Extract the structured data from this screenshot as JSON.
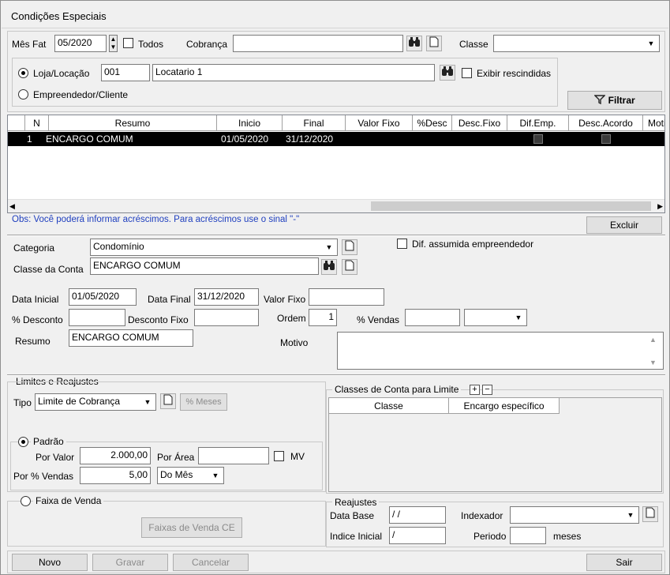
{
  "window": {
    "title": "Condições Especiais"
  },
  "filter": {
    "mes_fat_label": "Mês Fat",
    "mes_fat_value": "05/2020",
    "todos_label": "Todos",
    "cobranca_label": "Cobrança",
    "cobranca_value": "",
    "classe_label": "Classe",
    "classe_value": "",
    "loja_label": "Loja/Locação",
    "loja_code": "001",
    "loja_name": "Locatario 1",
    "exibir_rescindidas_label": "Exibir rescindidas",
    "empreendedor_label": "Empreendedor/Cliente",
    "filtrar_label": "Filtrar"
  },
  "grid": {
    "columns": [
      "N",
      "Resumo",
      "Inicio",
      "Final",
      "Valor Fixo",
      "%Desc",
      "Desc.Fixo",
      "Dif.Emp.",
      "Desc.Acordo",
      "Motiv"
    ],
    "rows": [
      {
        "n": "1",
        "resumo": "ENCARGO COMUM",
        "inicio": "01/05/2020",
        "final": "31/12/2020",
        "valor_fixo": "",
        "pct_desc": "",
        "desc_fixo": ""
      }
    ]
  },
  "notice": "Obs: Você poderá informar acréscimos. Para acréscimos use o sinal \"-\"",
  "excluir_label": "Excluir",
  "form": {
    "categoria_label": "Categoria",
    "categoria_value": "Condomínio",
    "dif_assumida_label": "Dif. assumida empreendedor",
    "classe_conta_label": "Classe da Conta",
    "classe_conta_value": "ENCARGO COMUM",
    "data_inicial_label": "Data Inicial",
    "data_inicial_value": "01/05/2020",
    "data_final_label": "Data Final",
    "data_final_value": "31/12/2020",
    "valor_fixo_label": "Valor Fixo",
    "valor_fixo_value": "",
    "pct_desconto_label": "% Desconto",
    "pct_desconto_value": "",
    "desconto_fixo_label": "Desconto Fixo",
    "desconto_fixo_value": "",
    "ordem_label": "Ordem",
    "ordem_value": "1",
    "pct_vendas_label": "% Vendas",
    "pct_vendas_value": "",
    "pct_vendas_select": "",
    "resumo_label": "Resumo",
    "resumo_value": "ENCARGO COMUM",
    "motivo_label": "Motivo",
    "motivo_value": ""
  },
  "limites": {
    "title": "Limites e Reajustes",
    "tipo_label": "Tipo",
    "tipo_value": "Limite de Cobrança",
    "meses_label": "% Meses",
    "padrao_label": "Padrão",
    "por_valor_label": "Por Valor",
    "por_valor_value": "2.000,00",
    "por_area_label": "Por Área",
    "por_area_value": "",
    "mv_label": "MV",
    "por_vendas_label": "Por % Vendas",
    "por_vendas_value": "5,00",
    "do_mes_value": "Do Mês",
    "faixa_label": "Faixa de Venda",
    "faixas_btn_label": "Faixas de Venda CE"
  },
  "classes_limite": {
    "title": "Classes de Conta para Limite",
    "columns": [
      "Classe",
      "Encargo específico"
    ]
  },
  "reajustes": {
    "title": "Reajustes",
    "data_base_label": "Data Base",
    "data_base_value": " / /",
    "indexador_label": "Indexador",
    "indexador_value": "",
    "indice_inicial_label": "Indice Inicial",
    "indice_inicial_value": " /",
    "periodo_label": "Periodo",
    "periodo_value": "",
    "meses_label": "meses"
  },
  "footer": {
    "novo_label": "Novo",
    "gravar_label": "Gravar",
    "cancelar_label": "Cancelar",
    "sair_label": "Sair"
  }
}
